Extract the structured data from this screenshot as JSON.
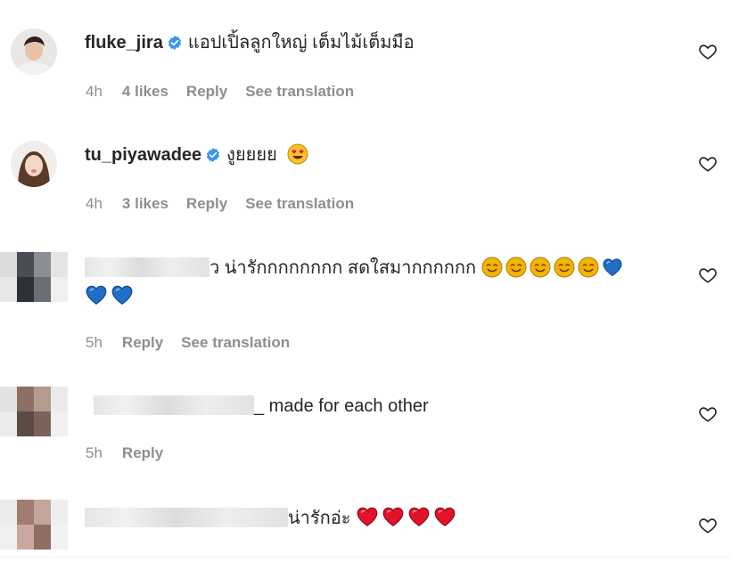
{
  "comments": [
    {
      "username": "fluke_jira",
      "verified": true,
      "text": "แอปเปิ้ลลูกใหญ่ เต็มไม้เต็มมือ",
      "time": "4h",
      "likes": "4 likes",
      "reply": "Reply",
      "translate": "See translation"
    },
    {
      "username": "tu_piyawadee",
      "verified": true,
      "text": "งูยยยย",
      "emoji": "heart-eyes",
      "time": "4h",
      "likes": "3 likes",
      "reply": "Reply",
      "translate": "See translation"
    },
    {
      "username_blurred": true,
      "text_tail": "ว น่ารักกกกกกกก สดใสมากกกกกก",
      "emoji_line1": [
        "smile",
        "smile",
        "smile",
        "smile",
        "smile",
        "blue-heart"
      ],
      "emoji_line2": [
        "blue-heart",
        "blue-heart"
      ],
      "time": "5h",
      "reply": "Reply",
      "translate": "See translation"
    },
    {
      "username_blurred": true,
      "text": "_ made for each other",
      "time": "5h",
      "reply": "Reply"
    },
    {
      "username_blurred": true,
      "text": "น่ารักอ่ะ",
      "emoji": [
        "red-heart",
        "red-heart",
        "red-heart",
        "red-heart"
      ]
    }
  ],
  "colors": {
    "text": "#262626",
    "meta": "#8e8e8e",
    "verified": "#3897f0",
    "blue_heart": "#1f6fc9",
    "red_heart": "#e0132b"
  }
}
